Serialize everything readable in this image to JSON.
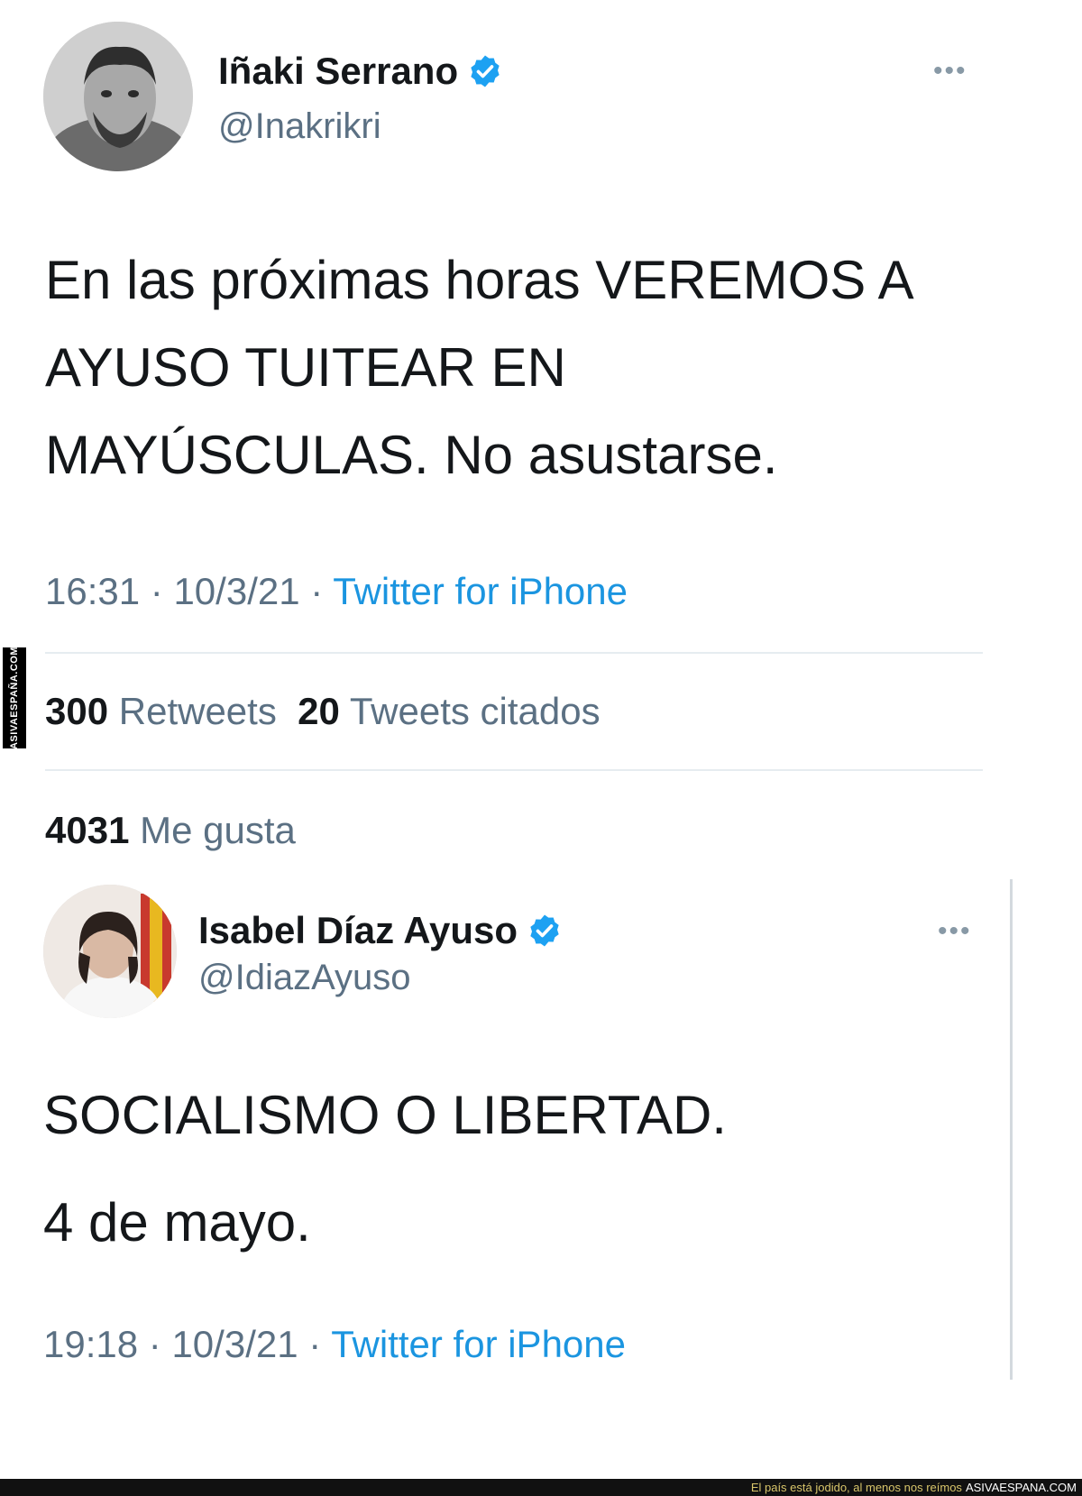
{
  "tweet1": {
    "author_name": "Iñaki Serrano",
    "handle": "@Inakrikri",
    "text_lines": [
      "En las próximas horas VEREMOS A",
      "AYUSO TUITEAR EN",
      "MAYÚSCULAS. No asustarse."
    ],
    "time": "16:31",
    "date": "10/3/21",
    "source": "Twitter for iPhone",
    "separator": "·",
    "retweets_count": "300",
    "retweets_label": "Retweets",
    "quotes_count": "20",
    "quotes_label": "Tweets citados",
    "likes_count": "4031",
    "likes_label": "Me gusta"
  },
  "tweet2": {
    "author_name": "Isabel Díaz Ayuso",
    "handle": "@IdiazAyuso",
    "text_line1": "SOCIALISMO O LIBERTAD.",
    "text_line2": "4 de mayo.",
    "time": "19:18",
    "date": "10/3/21",
    "source": "Twitter for iPhone",
    "separator": "·"
  },
  "more_menu_glyph": "•••",
  "icons": {
    "verified": "verified-badge-icon",
    "more": "more-options-icon"
  },
  "colors": {
    "verified_blue": "#1da1f2",
    "link_blue": "#1b95e0",
    "secondary_text": "#5b7083"
  },
  "watermark": {
    "side_text": "ASIVAESPAÑA.COM",
    "footer_tagline": "El país está jodido, al menos nos reímos",
    "footer_site": "ASIVAESPANA.COM"
  }
}
